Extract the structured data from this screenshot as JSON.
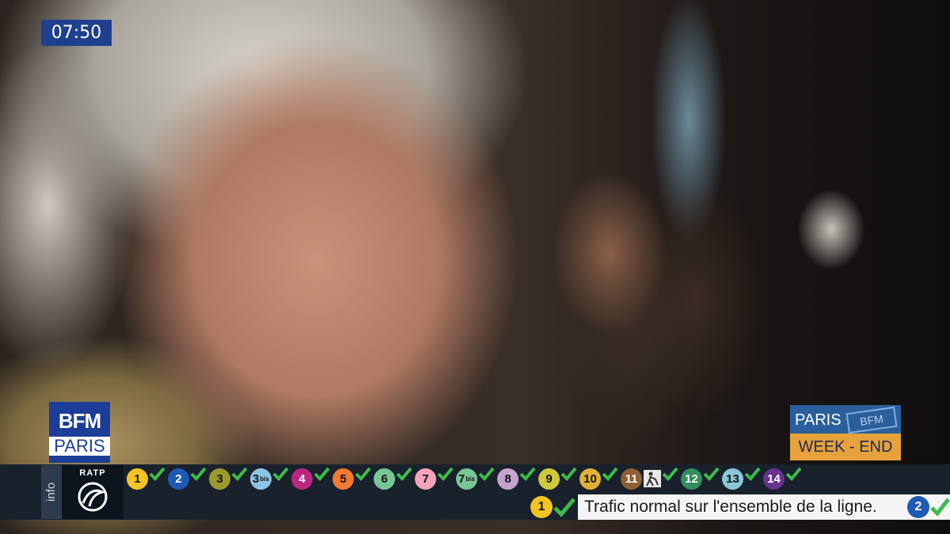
{
  "clock": "07:50",
  "channel_logo": {
    "line1": "BFM",
    "line2": "PARIS"
  },
  "program_logo": {
    "top": "PARIS",
    "badge": "BFM",
    "bottom": "WEEK - END"
  },
  "ticker": {
    "info_label": "info",
    "operator": "RATP",
    "lines": [
      {
        "num": "1",
        "sub": "",
        "bg": "#f2c523",
        "fg": "#111111"
      },
      {
        "num": "2",
        "sub": "",
        "bg": "#1e5ab4",
        "fg": "#ffffff"
      },
      {
        "num": "3",
        "sub": "",
        "bg": "#9b9a2a",
        "fg": "#111111"
      },
      {
        "num": "3",
        "sub": "bis",
        "bg": "#8cc4e6",
        "fg": "#111111"
      },
      {
        "num": "4",
        "sub": "",
        "bg": "#b8287f",
        "fg": "#ffffff"
      },
      {
        "num": "5",
        "sub": "",
        "bg": "#f07a32",
        "fg": "#111111"
      },
      {
        "num": "6",
        "sub": "",
        "bg": "#76c696",
        "fg": "#111111"
      },
      {
        "num": "7",
        "sub": "",
        "bg": "#f3a4ba",
        "fg": "#111111"
      },
      {
        "num": "7",
        "sub": "bis",
        "bg": "#77c696",
        "fg": "#111111"
      },
      {
        "num": "8",
        "sub": "",
        "bg": "#c5a3cd",
        "fg": "#111111"
      },
      {
        "num": "9",
        "sub": "",
        "bg": "#cdc83f",
        "fg": "#111111"
      },
      {
        "num": "10",
        "sub": "",
        "bg": "#dfb039",
        "fg": "#111111"
      },
      {
        "num": "11",
        "sub": "",
        "bg": "#8e5e34",
        "fg": "#ffffff",
        "extra": "worker-icon"
      },
      {
        "num": "12",
        "sub": "",
        "bg": "#328e5b",
        "fg": "#ffffff"
      },
      {
        "num": "13",
        "sub": "",
        "bg": "#89c7d6",
        "fg": "#111111"
      },
      {
        "num": "14",
        "sub": "",
        "bg": "#67328e",
        "fg": "#ffffff"
      }
    ],
    "status": {
      "line": "1",
      "line_bg": "#f2c523",
      "text": "Trafic normal sur l'ensemble de la ligne."
    },
    "next_line": {
      "num": "2",
      "bg": "#1e5ab4"
    }
  },
  "colors": {
    "check": "#3dbb4a",
    "bar": "#19212c"
  }
}
